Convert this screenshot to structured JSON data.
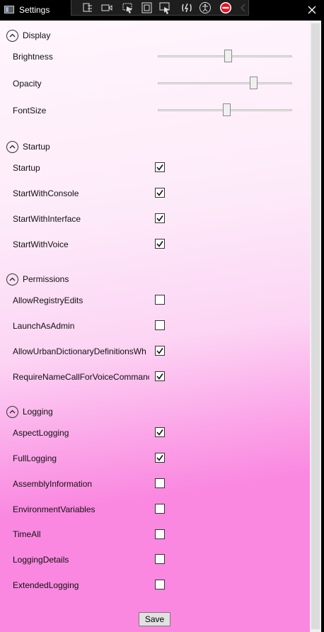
{
  "window": {
    "title": "Settings"
  },
  "toolbar": {
    "icons": [
      "live-visual-tree-icon",
      "record-icon",
      "select-element-icon",
      "display-layout-adorners-icon",
      "track-focus-icon",
      "hot-reload-icon",
      "accessibility-icon",
      "stop-icon",
      "collapse-chevron-icon"
    ]
  },
  "sections": {
    "display": {
      "title": "Display",
      "sliders": [
        {
          "label": "Brightness",
          "value": 0.52
        },
        {
          "label": "Opacity",
          "value": 0.71
        },
        {
          "label": "FontSize",
          "value": 0.51
        }
      ]
    },
    "startup": {
      "title": "Startup",
      "items": [
        {
          "label": "Startup",
          "checked": true
        },
        {
          "label": "StartWithConsole",
          "checked": true
        },
        {
          "label": "StartWithInterface",
          "checked": true
        },
        {
          "label": "StartWithVoice",
          "checked": true
        }
      ]
    },
    "permissions": {
      "title": "Permissions",
      "items": [
        {
          "label": "AllowRegistryEdits",
          "checked": false
        },
        {
          "label": "LaunchAsAdmin",
          "checked": false
        },
        {
          "label": "AllowUrbanDictionaryDefinitionsWh",
          "checked": true
        },
        {
          "label": "RequireNameCallForVoiceCommanc",
          "checked": true
        }
      ]
    },
    "logging": {
      "title": "Logging",
      "items": [
        {
          "label": "AspectLogging",
          "checked": true
        },
        {
          "label": "FullLogging",
          "checked": true
        },
        {
          "label": "AssemblyInformation",
          "checked": false
        },
        {
          "label": "EnvironmentVariables",
          "checked": false
        },
        {
          "label": "TimeAll",
          "checked": false
        },
        {
          "label": "LoggingDetails",
          "checked": false
        },
        {
          "label": "ExtendedLogging",
          "checked": false
        }
      ]
    }
  },
  "save_label": "Save"
}
